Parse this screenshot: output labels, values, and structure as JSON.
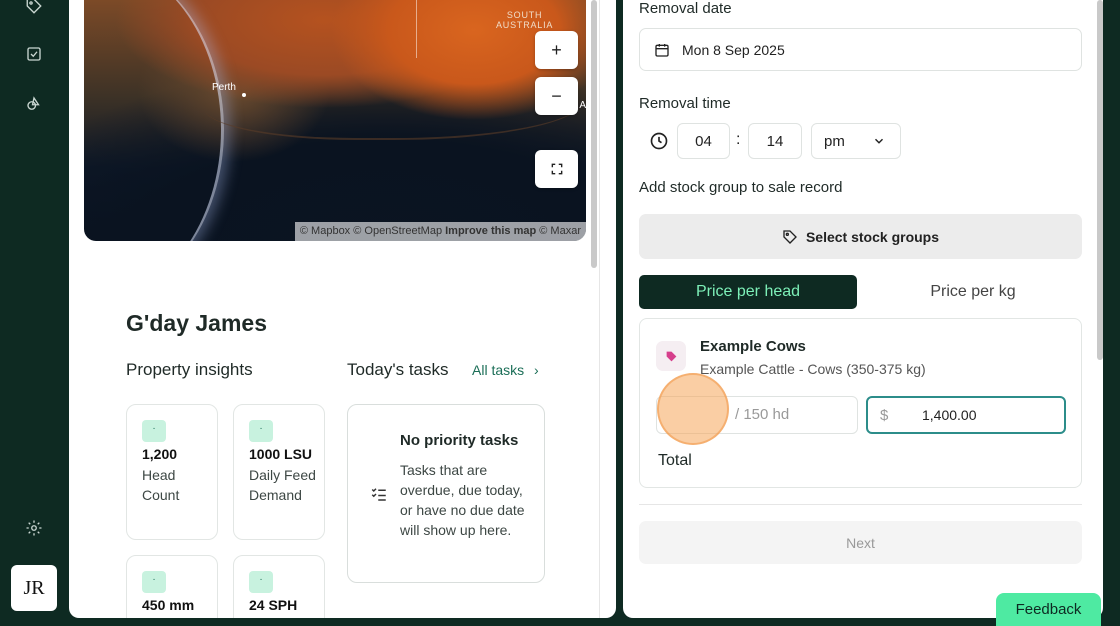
{
  "rail": {
    "icons": [
      "tag-icon",
      "checkbox-icon",
      "shapes-icon",
      "settings-icon"
    ],
    "avatar_initials": "JR"
  },
  "map": {
    "region_label": "SOUTH\nAUSTRALIA",
    "city_label": "Perth",
    "edge_label": "A",
    "zoom_in": "+",
    "zoom_out": "−",
    "attribution_prefix": "© Mapbox © OpenStreetMap",
    "attribution_link": "Improve this map",
    "attribution_suffix": "© Maxar"
  },
  "dashboard": {
    "greeting": "G'day James",
    "insights_title": "Property insights",
    "tasks_title": "Today's tasks",
    "all_tasks_link": "All tasks",
    "cards": [
      {
        "badge": "·",
        "value": "1,200",
        "label": "Head Count"
      },
      {
        "badge": "·",
        "value": "1000  LSU",
        "label": "Daily Feed Demand"
      },
      {
        "badge": "·",
        "value": "450  mm",
        "label": ""
      },
      {
        "badge": "·",
        "value": "24  SPH",
        "label": ""
      }
    ],
    "no_tasks_title": "No priority tasks",
    "no_tasks_desc": "Tasks that are overdue, due today, or have no due date will show up here."
  },
  "form": {
    "removal_date_label": "Removal date",
    "removal_date_value": "Mon 8 Sep 2025",
    "removal_time_label": "Removal time",
    "hour": "04",
    "minute": "14",
    "time_separator": ":",
    "ampm": "pm",
    "add_group_label": "Add stock group to sale record",
    "select_groups_button": "Select stock groups",
    "tab_price_head": "Price per head",
    "tab_price_kg": "Price per kg",
    "group_name": "Example Cows",
    "group_sub": "Example Cattle  - Cows (350-375 kg)",
    "qty_placeholder": "/ 150 hd",
    "currency": "$",
    "price_value": "1,400.00",
    "total_label": "Total",
    "next_button": "Next"
  },
  "feedback_button": "Feedback",
  "colors": {
    "nav_bg": "#0e2a22",
    "accent_green": "#4eeaa2",
    "tab_active_text": "#7df0b8",
    "link": "#1b6e57",
    "focus_border": "#2c8d8a"
  }
}
